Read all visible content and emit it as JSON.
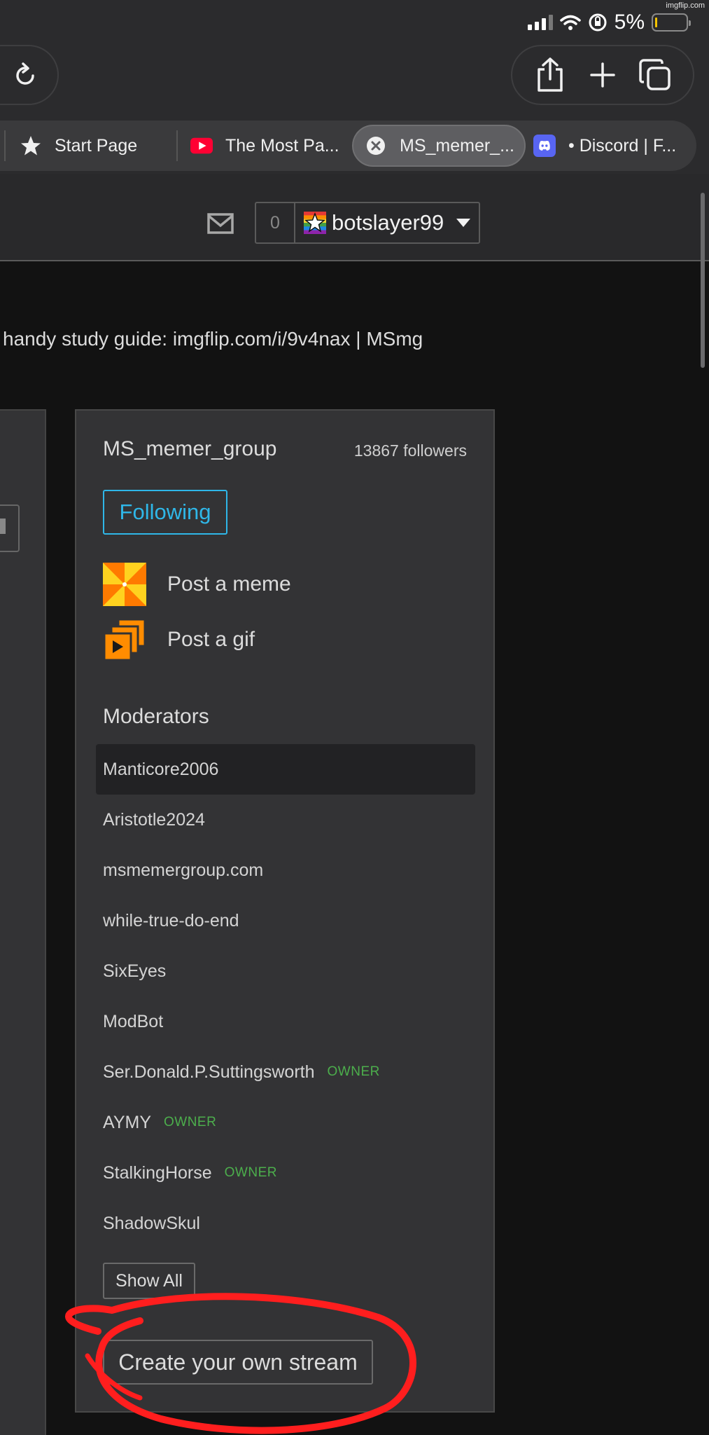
{
  "watermark": "imgflip.com",
  "status_bar": {
    "battery_percent": "5%",
    "battery_level": 0.05
  },
  "tabs": [
    {
      "label": "Start Page",
      "icon": "star-icon"
    },
    {
      "label": "The Most Pa...",
      "icon": "youtube-icon"
    },
    {
      "label": "MS_memer_...",
      "icon": "close-icon",
      "active": true
    },
    {
      "label": "• Discord | F...",
      "icon": "discord-icon"
    }
  ],
  "header": {
    "notification_count": "0",
    "username": "botslayer99"
  },
  "stream_description": "handy study guide: imgflip.com/i/9v4nax | MSmg",
  "sidebar": {
    "group_name": "MS_memer_group",
    "followers": "13867 followers",
    "following_label": "Following",
    "post_meme_label": "Post a meme",
    "post_gif_label": "Post a gif",
    "moderators_title": "Moderators",
    "moderators": [
      {
        "name": "Manticore2006",
        "badge": ""
      },
      {
        "name": "Aristotle2024",
        "badge": ""
      },
      {
        "name": "msmemergroup.com",
        "badge": ""
      },
      {
        "name": "while-true-do-end",
        "badge": ""
      },
      {
        "name": "SixEyes",
        "badge": ""
      },
      {
        "name": "ModBot",
        "badge": ""
      },
      {
        "name": "Ser.Donald.P.Suttingsworth",
        "badge": "OWNER"
      },
      {
        "name": "AYMY",
        "badge": "OWNER"
      },
      {
        "name": "StalkingHorse",
        "badge": "OWNER"
      },
      {
        "name": "ShadowSkul",
        "badge": ""
      }
    ],
    "show_all_label": "Show All",
    "create_stream_label": "Create your own stream"
  },
  "colors": {
    "following_accent": "#2fb7e8",
    "owner_badge": "#4cae4c",
    "annotation_red": "#ff1e1e"
  }
}
